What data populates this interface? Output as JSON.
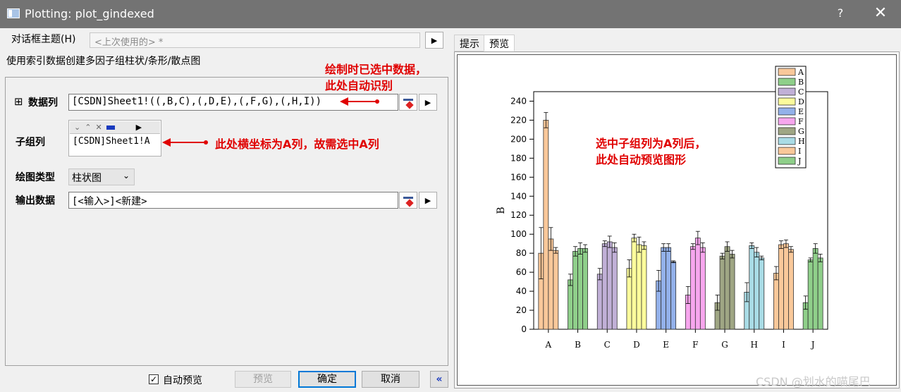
{
  "window": {
    "title": "Plotting: plot_gindexed",
    "help": "?",
    "close": "✕"
  },
  "dialog": {
    "theme_label": "对话框主题(H)",
    "theme_value": "<上次使用的> *",
    "description": "使用索引数据创建多因子组柱状/条形/散点图",
    "data_label": "数据列",
    "data_value": "[CSDN]Sheet1!((,B,C),(,D,E),(,F,G),(,H,I))",
    "subgroup_label": "子组列",
    "subgroup_value": "[CSDN]Sheet1!A",
    "plot_type_label": "绘图类型",
    "plot_type_value": "柱状图",
    "output_label": "输出数据",
    "output_value": "[<输入>]<新建>",
    "expand_icon": "⊞"
  },
  "annotations": {
    "data_note_1": "绘制时已选中数据，",
    "data_note_2": "此处自动识别",
    "subgroup_note": "此处横坐标为A列，故需选中A列",
    "preview_note_1": "选中子组列为A列后，",
    "preview_note_2": "此处自动预览图形"
  },
  "footer": {
    "auto_preview_label": "自动预览",
    "auto_preview_checked": true,
    "preview_button": "预览",
    "ok_button": "确定",
    "cancel_button": "取消",
    "collapse_button": "«"
  },
  "tabs": [
    {
      "label": "提示",
      "active": false
    },
    {
      "label": "预览",
      "active": true
    }
  ],
  "watermark": "CSDN @划水的喵尾巴",
  "chart_data": {
    "type": "bar",
    "ylabel": "B",
    "xlabel": "",
    "ylim": [
      0,
      250
    ],
    "yticks": [
      0,
      20,
      40,
      60,
      80,
      100,
      120,
      140,
      160,
      180,
      200,
      220,
      240
    ],
    "categories": [
      "A",
      "B",
      "C",
      "D",
      "E",
      "F",
      "G",
      "H",
      "I",
      "J"
    ],
    "legend": {
      "position": "top-right",
      "entries": [
        {
          "name": "A",
          "color": "#f9c89a"
        },
        {
          "name": "B",
          "color": "#8fcf8a"
        },
        {
          "name": "C",
          "color": "#c1b0d7"
        },
        {
          "name": "D",
          "color": "#fcfc9c"
        },
        {
          "name": "E",
          "color": "#93b1ea"
        },
        {
          "name": "F",
          "color": "#f7a6ee"
        },
        {
          "name": "G",
          "color": "#9fa684"
        },
        {
          "name": "H",
          "color": "#a9dce6"
        },
        {
          "name": "I",
          "color": "#f9c89a"
        },
        {
          "name": "J",
          "color": "#8fcf8a"
        }
      ]
    },
    "groups": [
      {
        "category": "A",
        "color": "#f9c89a",
        "values": [
          80,
          220,
          95,
          83
        ],
        "errors": [
          27,
          8,
          12,
          3
        ]
      },
      {
        "category": "B",
        "color": "#8fcf8a",
        "values": [
          52,
          82,
          85,
          85
        ],
        "errors": [
          6,
          5,
          6,
          4
        ]
      },
      {
        "category": "C",
        "color": "#c1b0d7",
        "values": [
          58,
          90,
          92,
          86
        ],
        "errors": [
          6,
          3,
          6,
          5
        ]
      },
      {
        "category": "D",
        "color": "#fcfc9c",
        "values": [
          64,
          96,
          89,
          88
        ],
        "errors": [
          9,
          4,
          8,
          4
        ]
      },
      {
        "category": "E",
        "color": "#93b1ea",
        "values": [
          51,
          86,
          86,
          71
        ],
        "errors": [
          11,
          4,
          4,
          1
        ]
      },
      {
        "category": "F",
        "color": "#f7a6ee",
        "values": [
          36,
          87,
          96,
          86
        ],
        "errors": [
          9,
          3,
          7,
          5
        ]
      },
      {
        "category": "G",
        "color": "#9fa684",
        "values": [
          28,
          77,
          87,
          79
        ],
        "errors": [
          8,
          3,
          5,
          4
        ]
      },
      {
        "category": "H",
        "color": "#a9dce6",
        "values": [
          39,
          88,
          81,
          75
        ],
        "errors": [
          10,
          3,
          5,
          2
        ]
      },
      {
        "category": "I",
        "color": "#f9c89a",
        "values": [
          59,
          89,
          90,
          84
        ],
        "errors": [
          7,
          4,
          4,
          3
        ]
      },
      {
        "category": "J",
        "color": "#8fcf8a",
        "values": [
          28,
          73,
          85,
          75
        ],
        "errors": [
          7,
          2,
          5,
          4
        ]
      }
    ]
  }
}
